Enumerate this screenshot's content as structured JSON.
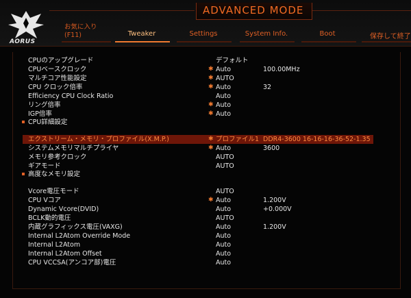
{
  "header": {
    "mode_title": "ADVANCED MODE",
    "logo_text": "AORUS",
    "favorites_line1": "お気に入り",
    "favorites_line2": "(F11)",
    "tabs": [
      {
        "label": "Tweaker",
        "active": true
      },
      {
        "label": "Settings",
        "active": false
      },
      {
        "label": "System Info.",
        "active": false
      },
      {
        "label": "Boot",
        "active": false
      }
    ],
    "save_exit": "保存して終了"
  },
  "colors": {
    "accent": "#f07a30",
    "highlight_bg": "#6e1608",
    "text": "#e8e8e8",
    "background": "#050505"
  },
  "settings": [
    {
      "label": "CPUのアップグレード",
      "value": "デフォルト",
      "extra": "",
      "star": false
    },
    {
      "label": "CPUベースクロック",
      "value": "Auto",
      "extra": "100.00MHz",
      "star": true
    },
    {
      "label": "マルチコア性能設定",
      "value": "AUTO",
      "extra": "",
      "star": true
    },
    {
      "label": "CPU クロック倍率",
      "value": "Auto",
      "extra": "32",
      "star": true
    },
    {
      "label": "Efficiency CPU Clock Ratio",
      "value": "Auto",
      "extra": "",
      "star": false
    },
    {
      "label": "リング倍率",
      "value": "Auto",
      "extra": "",
      "star": true
    },
    {
      "label": "IGP倍率",
      "value": "Auto",
      "extra": "",
      "star": true
    },
    {
      "label": "CPU詳細設定",
      "value": "",
      "extra": "",
      "star": false,
      "submenu": true
    },
    {
      "label": "エクストリーム・メモリ・プロファイル(X.M.P.)",
      "value": "プロファイル1",
      "extra": "DDR4-3600 16-16-16-36-52-1.35",
      "star": true,
      "highlight": true
    },
    {
      "label": "システムメモリマルチプライヤ",
      "value": "Auto",
      "extra": "3600",
      "star": true
    },
    {
      "label": "メモリ参考クロック",
      "value": "AUTO",
      "extra": "",
      "star": false
    },
    {
      "label": "ギアモード",
      "value": "AUTO",
      "extra": "",
      "star": false
    },
    {
      "label": "高度なメモリ設定",
      "value": "",
      "extra": "",
      "star": false,
      "submenu": true
    },
    {
      "label": "Vcore電圧モード",
      "value": "AUTO",
      "extra": "",
      "star": false
    },
    {
      "label": "CPU Vコア",
      "value": "Auto",
      "extra": "1.200V",
      "star": true
    },
    {
      "label": "Dynamic Vcore(DVID)",
      "value": "Auto",
      "extra": "+0.000V",
      "star": false
    },
    {
      "label": "BCLK動的電圧",
      "value": "AUTO",
      "extra": "",
      "star": false
    },
    {
      "label": "内蔵グラフィックス電圧(VAXG)",
      "value": "Auto",
      "extra": "1.200V",
      "star": false
    },
    {
      "label": "Internal L2Atom Override Mode",
      "value": "Auto",
      "extra": "",
      "star": false
    },
    {
      "label": "Internal L2Atom",
      "value": "Auto",
      "extra": "",
      "star": false
    },
    {
      "label": "Internal L2Atom Offset",
      "value": "Auto",
      "extra": "",
      "star": false
    },
    {
      "label": "CPU VCCSA(アンコア部)電圧",
      "value": "Auto",
      "extra": "",
      "star": false
    }
  ]
}
